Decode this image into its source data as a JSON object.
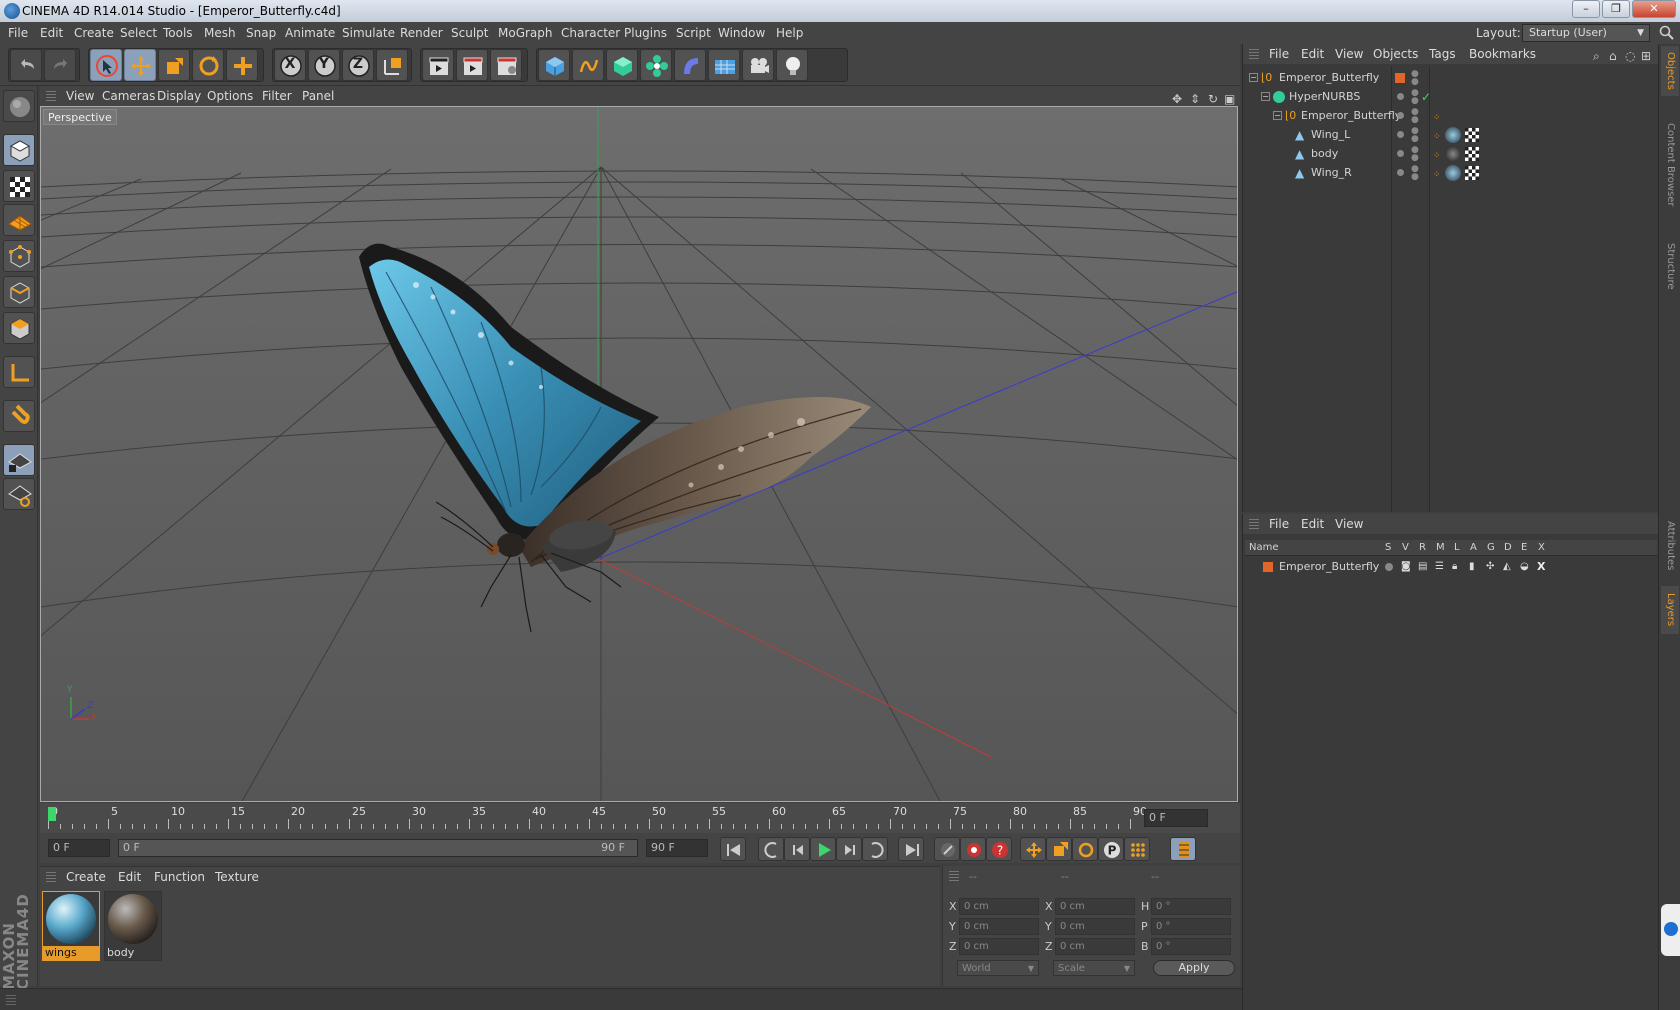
{
  "window": {
    "title": "CINEMA 4D R14.014 Studio - [Emperor_Butterfly.c4d]",
    "btn_min": "–",
    "btn_max": "❐",
    "btn_close": "✕"
  },
  "menubar": {
    "items": [
      "File",
      "Edit",
      "Create",
      "Select",
      "Tools",
      "Mesh",
      "Snap",
      "Animate",
      "Simulate",
      "Render",
      "Sculpt",
      "MoGraph",
      "Character",
      "Plugins",
      "Script",
      "Window",
      "Help"
    ],
    "layout_label": "Layout:",
    "layout_value": "Startup (User)"
  },
  "toolbar": {
    "axis_x": "X",
    "axis_y": "Y",
    "axis_z": "Z"
  },
  "viewport": {
    "menu": [
      "View",
      "Cameras",
      "Display",
      "Options",
      "Filter",
      "Panel"
    ],
    "label": "Perspective",
    "axis_y": "Y",
    "axis_x": "X",
    "axis_z": "Z"
  },
  "timeline": {
    "ticks": [
      "0",
      "5",
      "10",
      "15",
      "20",
      "25",
      "30",
      "35",
      "40",
      "45",
      "50",
      "55",
      "60",
      "65",
      "70",
      "75",
      "80",
      "85",
      "90"
    ],
    "end_field": "0 F"
  },
  "transport": {
    "current": "0 F",
    "range_start": "0 F",
    "range_end": "90 F",
    "max": "90 F"
  },
  "materials": {
    "menu": [
      "Create",
      "Edit",
      "Function",
      "Texture"
    ],
    "items": [
      {
        "name": "wings"
      },
      {
        "name": "body"
      }
    ]
  },
  "coords": {
    "head": [
      "--",
      "--",
      "--"
    ],
    "row_labels_a": [
      "X",
      "Y",
      "Z"
    ],
    "row_labels_b": [
      "X",
      "Y",
      "Z"
    ],
    "row_labels_c": [
      "H",
      "P",
      "B"
    ],
    "pos": [
      "0 cm",
      "0 cm",
      "0 cm"
    ],
    "size": [
      "0 cm",
      "0 cm",
      "0 cm"
    ],
    "rot": [
      "0 °",
      "0 °",
      "0 °"
    ],
    "world": "World",
    "scale": "Scale",
    "apply": "Apply"
  },
  "objects": {
    "menu": [
      "File",
      "Edit",
      "View",
      "Objects",
      "Tags",
      "Bookmarks"
    ],
    "rows": [
      {
        "name": "Emperor_Butterfly"
      },
      {
        "name": "HyperNURBS"
      },
      {
        "name": "Emperor_Butterfly"
      },
      {
        "name": "Wing_L"
      },
      {
        "name": "body"
      },
      {
        "name": "Wing_R"
      }
    ]
  },
  "layers": {
    "menu": [
      "File",
      "Edit",
      "View"
    ],
    "col_name": "Name",
    "cols": [
      "S",
      "V",
      "R",
      "M",
      "L",
      "A",
      "G",
      "D",
      "E",
      "X"
    ],
    "row_name": "Emperor_Butterfly"
  },
  "side_tabs": [
    "Objects",
    "Content Browser",
    "Structure",
    "Attributes",
    "Layers"
  ],
  "colors": {
    "accent": "#e79b2a",
    "selected_tool": "#8ca1b9",
    "wing_blue": "#3a8fb5"
  }
}
